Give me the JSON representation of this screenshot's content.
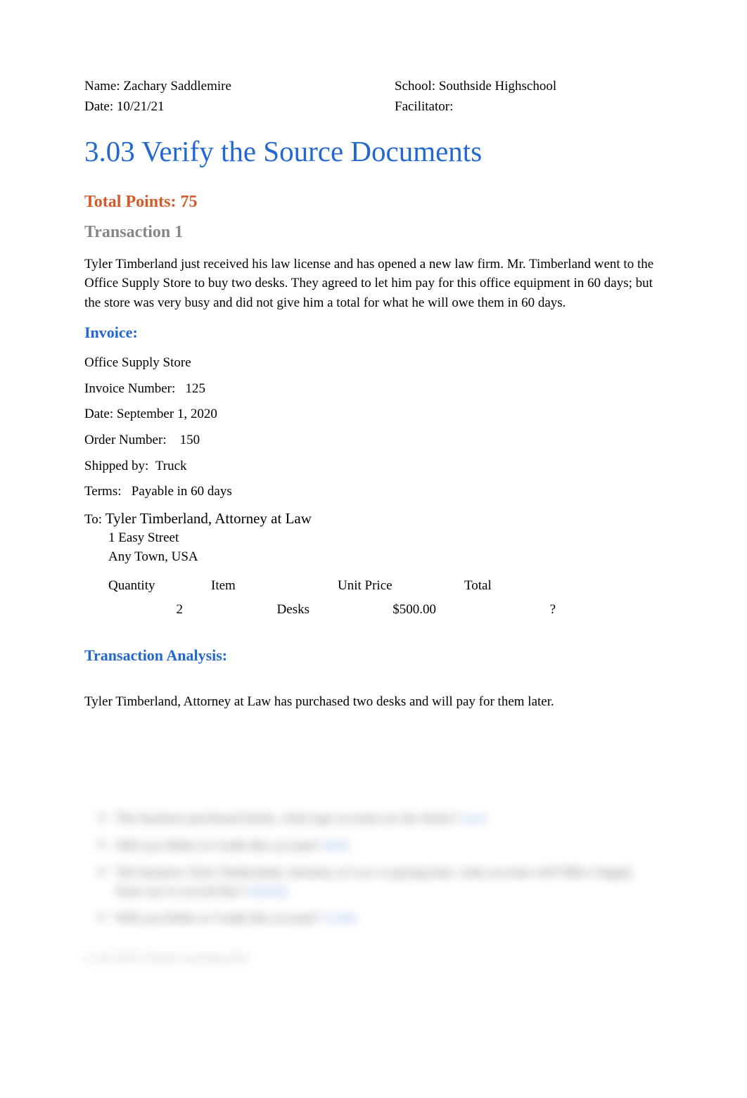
{
  "header": {
    "name_label": "Name: ",
    "name_value": "Zachary Saddlemire",
    "date_label": "Date: ",
    "date_value": "10/21/21",
    "school_label": "School: ",
    "school_value": "Southside Highschool",
    "facilitator_label": "Facilitator:",
    "facilitator_value": ""
  },
  "title": "3.03 Verify the Source Documents",
  "points": "Total Points: 75",
  "transaction_label": "Transaction 1",
  "intro_paragraph": "Tyler Timberland just received his law license and has opened a new law firm. Mr. Timberland went to the Office Supply Store to buy two desks. They agreed to let him pay for this office equipment in 60 days; but the store was very busy and did not give him a total for what he will owe them in 60 days.",
  "invoice": {
    "heading": "Invoice:",
    "store": "Office Supply Store",
    "invoice_number_label": "Invoice Number:",
    "invoice_number_value": "125",
    "date_label": "Date:",
    "date_value": "September 1, 2020",
    "order_number_label": "Order Number:",
    "order_number_value": "150",
    "shipped_by_label": "Shipped by:",
    "shipped_by_value": "Truck",
    "terms_label": "Terms:",
    "terms_value": "Payable in 60 days",
    "to_label": "To:",
    "to_name": "Tyler Timberland, Attorney at Law",
    "to_street": "1 Easy Street",
    "to_city": "Any Town, USA",
    "table": {
      "headers": {
        "quantity": "Quantity",
        "item": "Item",
        "unit_price": "Unit Price",
        "total": "Total"
      },
      "row": {
        "quantity": "2",
        "item": "Desks",
        "unit_price": "$500.00",
        "total": "?"
      }
    }
  },
  "analysis": {
    "heading": "Transaction Analysis:",
    "text": "Tyler Timberland, Attorney at Law has purchased two desks and will pay for them later."
  },
  "blurred": {
    "q1_text": "The business purchased desks, what type account are the desks?",
    "q1_answer": "asset",
    "q2_text": "Will you Debit or Credit this account?",
    "q2_answer": "debit",
    "q3_text": "The business Tyler Timberland, Attorney at Law is paying later, what account will Office Supply Store use to record this?",
    "q3_answer": "liability",
    "q4_text": "Will you Debit or Credit this account?",
    "q4_answer": "Credit"
  },
  "copyright": "© ACCESS Virtual Learning 2021"
}
